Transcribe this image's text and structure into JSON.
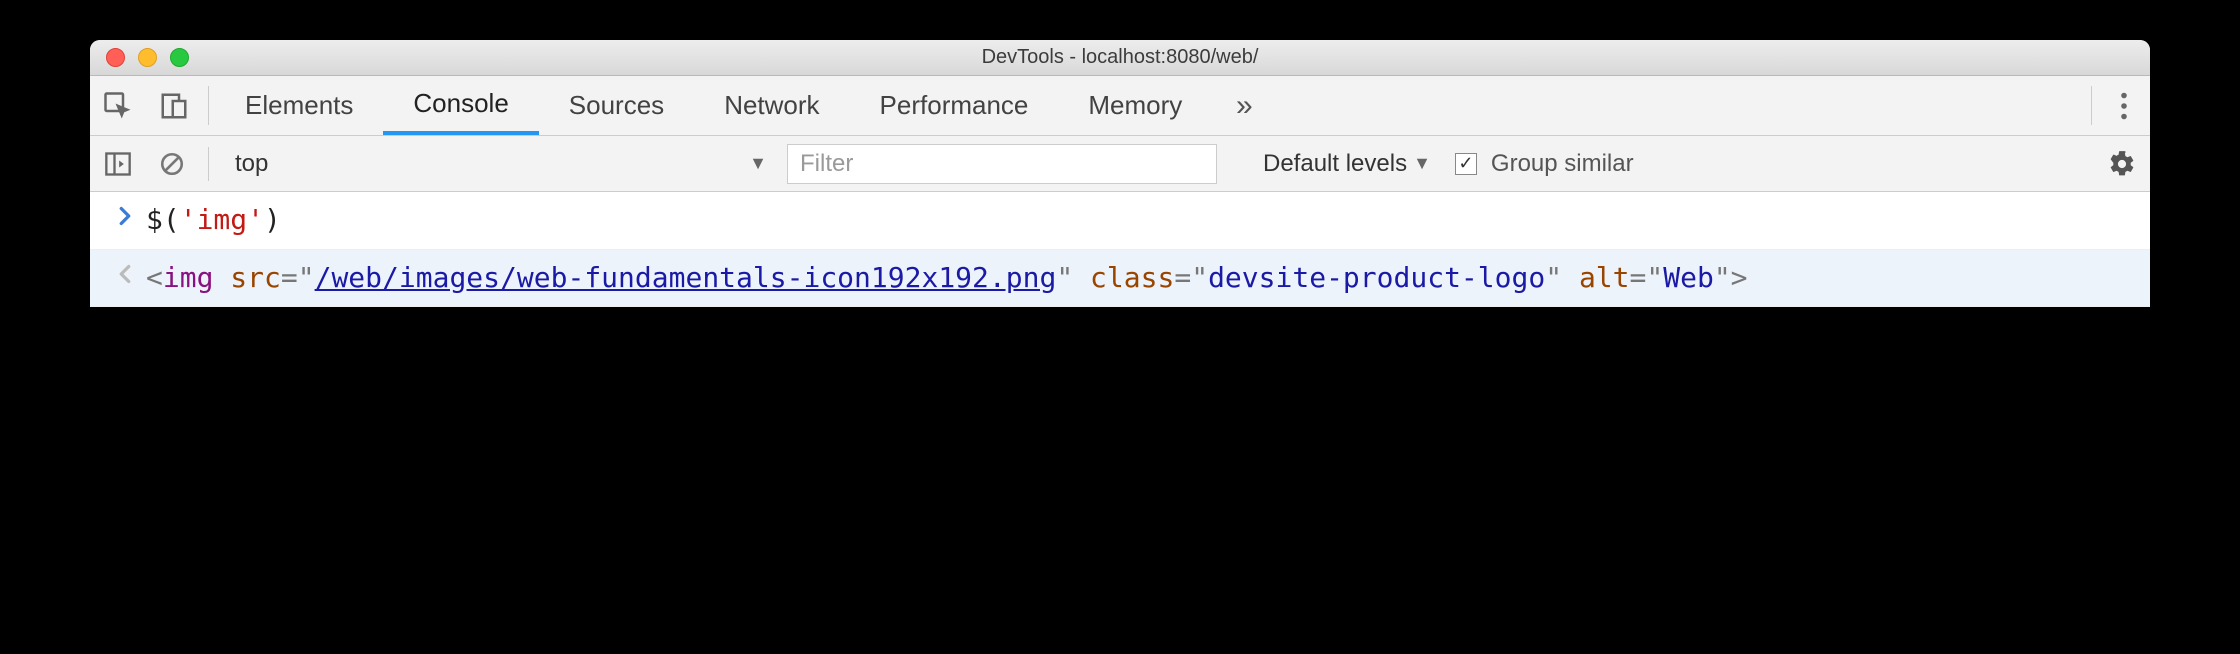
{
  "window": {
    "title": "DevTools - localhost:8080/web/"
  },
  "tabs": {
    "items": [
      "Elements",
      "Console",
      "Sources",
      "Network",
      "Performance",
      "Memory"
    ],
    "active_index": 1,
    "overflow_glyph": "»"
  },
  "toolbar": {
    "context": "top",
    "filter_placeholder": "Filter",
    "levels_label": "Default levels",
    "group_similar_label": "Group similar",
    "group_similar_checked": true
  },
  "console": {
    "input_prefix": "$",
    "input_paren_open": "(",
    "input_arg": "'img'",
    "input_paren_close": ")",
    "output": {
      "open": "<",
      "tag": "img",
      "attrs": [
        {
          "name": "src",
          "value": "/web/images/web-fundamentals-icon192x192.png",
          "is_url": true
        },
        {
          "name": "class",
          "value": "devsite-product-logo",
          "is_url": false
        },
        {
          "name": "alt",
          "value": "Web",
          "is_url": false
        }
      ],
      "close": ">"
    }
  }
}
